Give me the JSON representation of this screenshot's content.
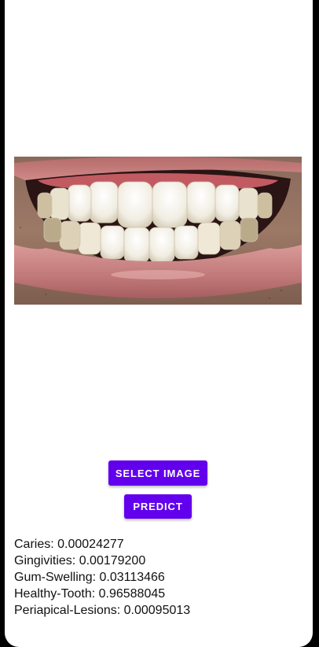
{
  "image": {
    "subject": "close-up of smiling mouth showing teeth"
  },
  "buttons": {
    "select_image": "SELECT IMAGE",
    "predict": "PREDICT"
  },
  "results": [
    "Caries: 0.00024277",
    "Gingivities: 0.00179200",
    "Gum-Swelling: 0.03113466",
    "Healthy-Tooth: 0.96588045",
    "Periapical-Lesions: 0.00095013"
  ],
  "colors": {
    "accent": "#6200ee",
    "background": "#ffffff",
    "frame": "#000000"
  }
}
